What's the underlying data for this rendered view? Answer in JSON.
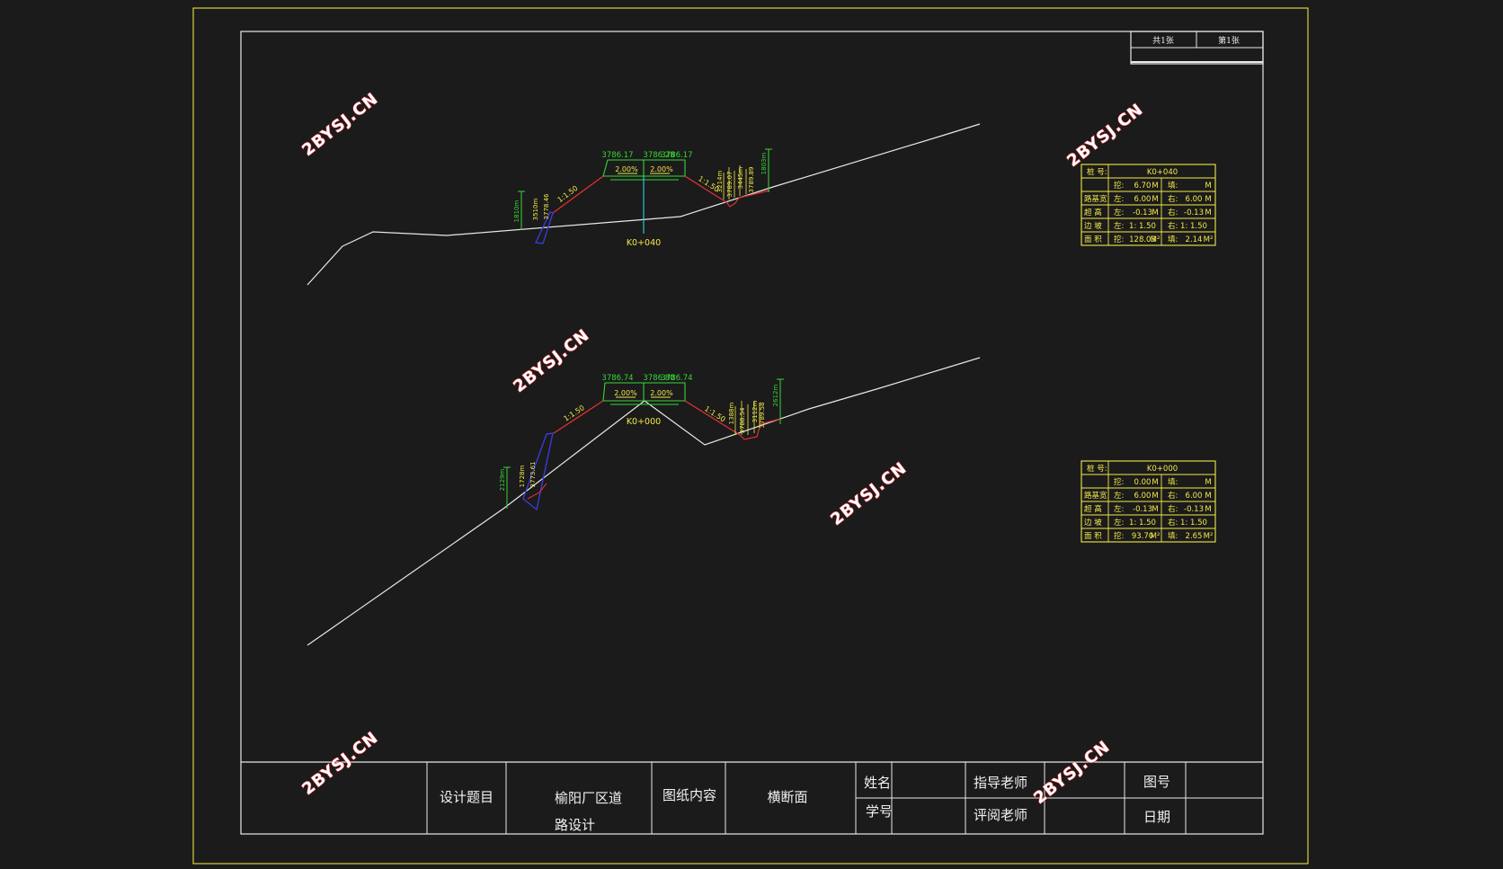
{
  "colors": {
    "background": "#1b1b1b",
    "outer_frame": "#d8d23a",
    "inner_frame": "#e8e8e8",
    "ground_line": "#e8e8e8",
    "slope_line": "#e23030",
    "dimension": "#37d437",
    "annotation": "#f2e84a",
    "ditch": "#3a3ad8",
    "center_line": "#29c7d6",
    "watermark_fill": "#ffffff",
    "watermark_stroke": "#e2323a"
  },
  "sheet_box": {
    "total": "共1张",
    "current": "第1张"
  },
  "watermark": "2BYSJ.CN",
  "sections": [
    {
      "id": "k0040",
      "station_label": "K0+040",
      "left_slope_label": "1:1.50",
      "right_slope_label": "1:1.50",
      "left_crossfall": "2.00%",
      "right_crossfall": "2.00%",
      "elev_top_left": "3786.17",
      "elev_top_mid": "3786.28",
      "elev_top_right": "3786.17",
      "dim_left_outer": "1810m",
      "dim_left_inner": "3510m",
      "dim_left_elev": "3778.46",
      "dim_right_a": "3214m",
      "dim_right_b": "3789.07",
      "dim_right_c": "3445m",
      "dim_right_d": "3789.89",
      "dim_right_outer": "1803m",
      "table": {
        "rows": [
          [
            "桩    号:",
            "K0+040",
            ""
          ],
          [
            "挖:",
            "6.70",
            "M",
            "填:",
            "",
            "M"
          ],
          [
            "路基宽",
            "左:",
            "6.00",
            "M",
            "右:",
            "6.00",
            "M"
          ],
          [
            "超  高",
            "左:",
            "-0.13",
            "M",
            "右:",
            "-0.13",
            "M"
          ],
          [
            "边  坡",
            "左:",
            "1: 1.50",
            "",
            "右:",
            "1: 1.50",
            ""
          ],
          [
            "面  积",
            "挖:",
            "128.03",
            "M²",
            "填:",
            "2.14",
            "M²"
          ]
        ]
      }
    },
    {
      "id": "k0000",
      "station_label": "K0+000",
      "left_slope_label": "1:1.50",
      "right_slope_label": "1:1.50",
      "left_crossfall": "2.00%",
      "right_crossfall": "2.00%",
      "elev_top_left": "3786.74",
      "elev_top_mid": "3786.80",
      "elev_top_right": "3786.74",
      "dim_left_outer": "2129m",
      "dim_left_inner": "1728m",
      "dim_left_elev": "3773.61",
      "dim_right_a": "1388m",
      "dim_right_b": "3788.54",
      "dim_right_c": "3112m",
      "dim_right_d": "3789.58",
      "dim_right_outer": "2612m",
      "table": {
        "rows": [
          [
            "桩    号:",
            "K0+000",
            ""
          ],
          [
            "挖:",
            "0.00",
            "M",
            "填:",
            "",
            "M"
          ],
          [
            "路基宽",
            "左:",
            "6.00",
            "M",
            "右:",
            "6.00",
            "M"
          ],
          [
            "超  高",
            "左:",
            "-0.13",
            "M",
            "右:",
            "-0.13",
            "M"
          ],
          [
            "边  坡",
            "左:",
            "1: 1.50",
            "",
            "右:",
            "1: 1.50",
            ""
          ],
          [
            "面  积",
            "挖:",
            "93.70",
            "M²",
            "填:",
            "2.65",
            "M²"
          ]
        ]
      }
    }
  ],
  "title_block": {
    "design_topic_label": "设计题目",
    "design_topic_line1": "榆阳厂区道",
    "design_topic_line2": "路设计",
    "drawing_content_label": "图纸内容",
    "drawing_content_value": "横断面",
    "name_label": "姓名",
    "student_id_label": "学号",
    "advisor_label": "指导老师",
    "reviewer_label": "评阅老师",
    "drawing_no_label": "图号",
    "date_label": "日期"
  }
}
